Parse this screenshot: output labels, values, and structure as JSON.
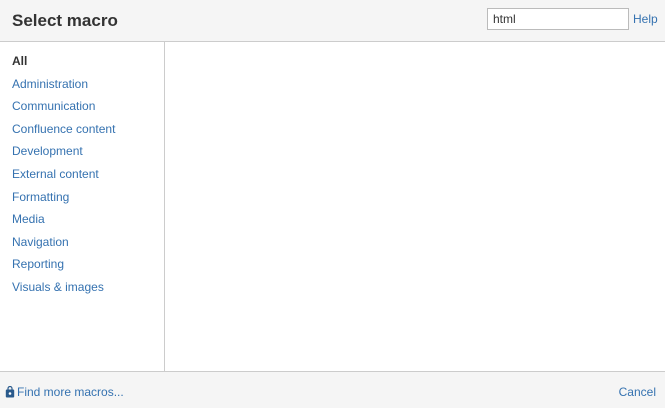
{
  "dialog": {
    "title": "Select macro"
  },
  "search": {
    "value": "html"
  },
  "help_label": "Help",
  "categories": [
    {
      "label": "All"
    },
    {
      "label": "Administration"
    },
    {
      "label": "Communication"
    },
    {
      "label": "Confluence content"
    },
    {
      "label": "Development"
    },
    {
      "label": "External content"
    },
    {
      "label": "Formatting"
    },
    {
      "label": "Media"
    },
    {
      "label": "Navigation"
    },
    {
      "label": "Reporting"
    },
    {
      "label": "Visuals & images"
    }
  ],
  "selected_category": "All",
  "footer": {
    "find_more_label": "Find more macros...",
    "find_more_icon": "shopping-bag-icon",
    "cancel_label": "Cancel"
  },
  "colors": {
    "link": "#3572b0",
    "header_bg": "#f5f5f5",
    "border": "#cccccc",
    "text": "#333333"
  }
}
